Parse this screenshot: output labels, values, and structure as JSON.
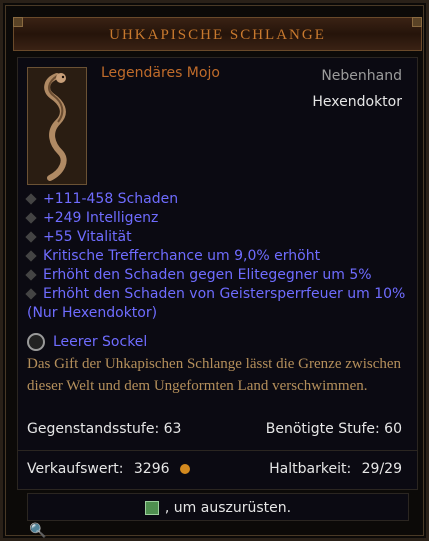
{
  "header": {
    "title": "UHKAPISCHE SCHLANGE"
  },
  "item": {
    "rarity": "Legendäres Mojo",
    "slot": "Nebenhand",
    "class": "Hexendoktor",
    "affixes": [
      "+111-458 Schaden",
      "+249 Intelligenz",
      "+55 Vitalität",
      "Kritische Trefferchance um 9,0% erhöht",
      "Erhöht den Schaden gegen Elitegegner um 5%",
      "Erhöht den Schaden von Geistersperrfeuer um 10%",
      "(Nur Hexendoktor)"
    ],
    "socket_label": "Leerer Sockel",
    "flavor": "Das Gift der Uhkapischen Schlange lässt die Grenze zwischen dieser Welt und dem Ungeformten Land verschwimmen.",
    "item_level_label": "Gegenstandsstufe: 63",
    "required_level_label": "Benötigte Stufe: 60",
    "sell_value_label": "Verkaufswert:",
    "sell_value": "3296",
    "durability_label": "Haltbarkeit:",
    "durability_value": "29/29"
  },
  "hint": {
    "text": ", um auszurüsten."
  },
  "icons": {
    "gold": "gold-coin-icon",
    "socket": "socket-icon",
    "key": "key-hint-icon",
    "search": "search-icon"
  }
}
